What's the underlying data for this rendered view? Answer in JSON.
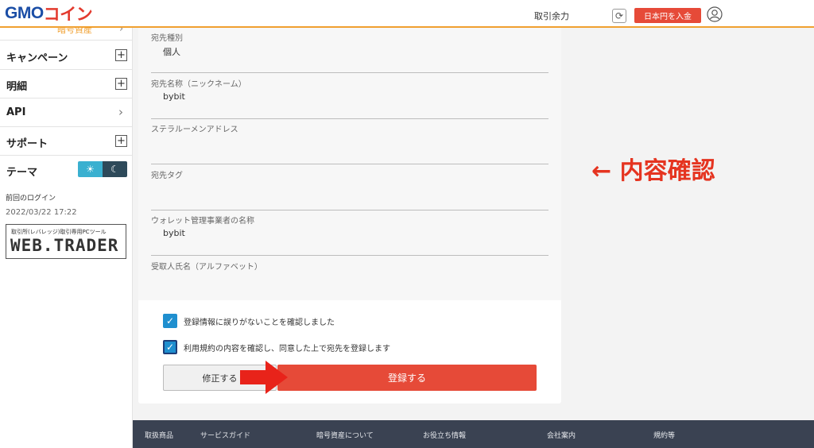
{
  "header": {
    "logo_gmo": "GMO",
    "logo_coin": "コイン",
    "trade_power_label": "取引余力",
    "refresh_icon": "refresh-icon",
    "deposit_button": "日本円を入金",
    "user_icon": "user-icon"
  },
  "sidebar": {
    "cut_item": "暗号資産",
    "items": [
      {
        "label": "キャンペーン",
        "control": "plus"
      },
      {
        "label": "明細",
        "control": "plus"
      },
      {
        "label": "API",
        "control": "chevron"
      },
      {
        "label": "サポート",
        "control": "plus"
      },
      {
        "label": "テーマ",
        "control": "theme-toggle"
      }
    ],
    "last_login_label": "前回のログイン",
    "last_login_time": "2022/03/22 17:22",
    "webtrader_sub": "取引所(レバレッジ)取引専用PCツール",
    "webtrader_main": "WEB.TRADER"
  },
  "form": {
    "fields": [
      {
        "label": "宛先種別",
        "value": "個人"
      },
      {
        "label": "宛先名称（ニックネーム）",
        "value": "bybit"
      },
      {
        "label": "ステラルーメンアドレス",
        "value": ""
      },
      {
        "label": "宛先タグ",
        "value": ""
      },
      {
        "label": "ウォレット管理事業者の名称",
        "value": "bybit"
      },
      {
        "label": "受取人氏名（アルファベット）",
        "value": ""
      }
    ],
    "checks": [
      {
        "label": "登録情報に誤りがないことを確認しました",
        "checked": true
      },
      {
        "label": "利用規約の内容を確認し、同意した上で宛先を登録します",
        "checked": true
      }
    ],
    "edit_button": "修正する",
    "register_button": "登録する"
  },
  "annotation": "← 内容確認",
  "colors": {
    "accent_red": "#e64a38",
    "check_blue": "#1f8fcf",
    "header_rule": "#f0a030",
    "footer_bg": "#3a4252"
  },
  "footer": {
    "links": [
      "取扱商品",
      "サービスガイド",
      "暗号資産について",
      "お役立ち情報",
      "会社案内",
      "規約等"
    ]
  }
}
